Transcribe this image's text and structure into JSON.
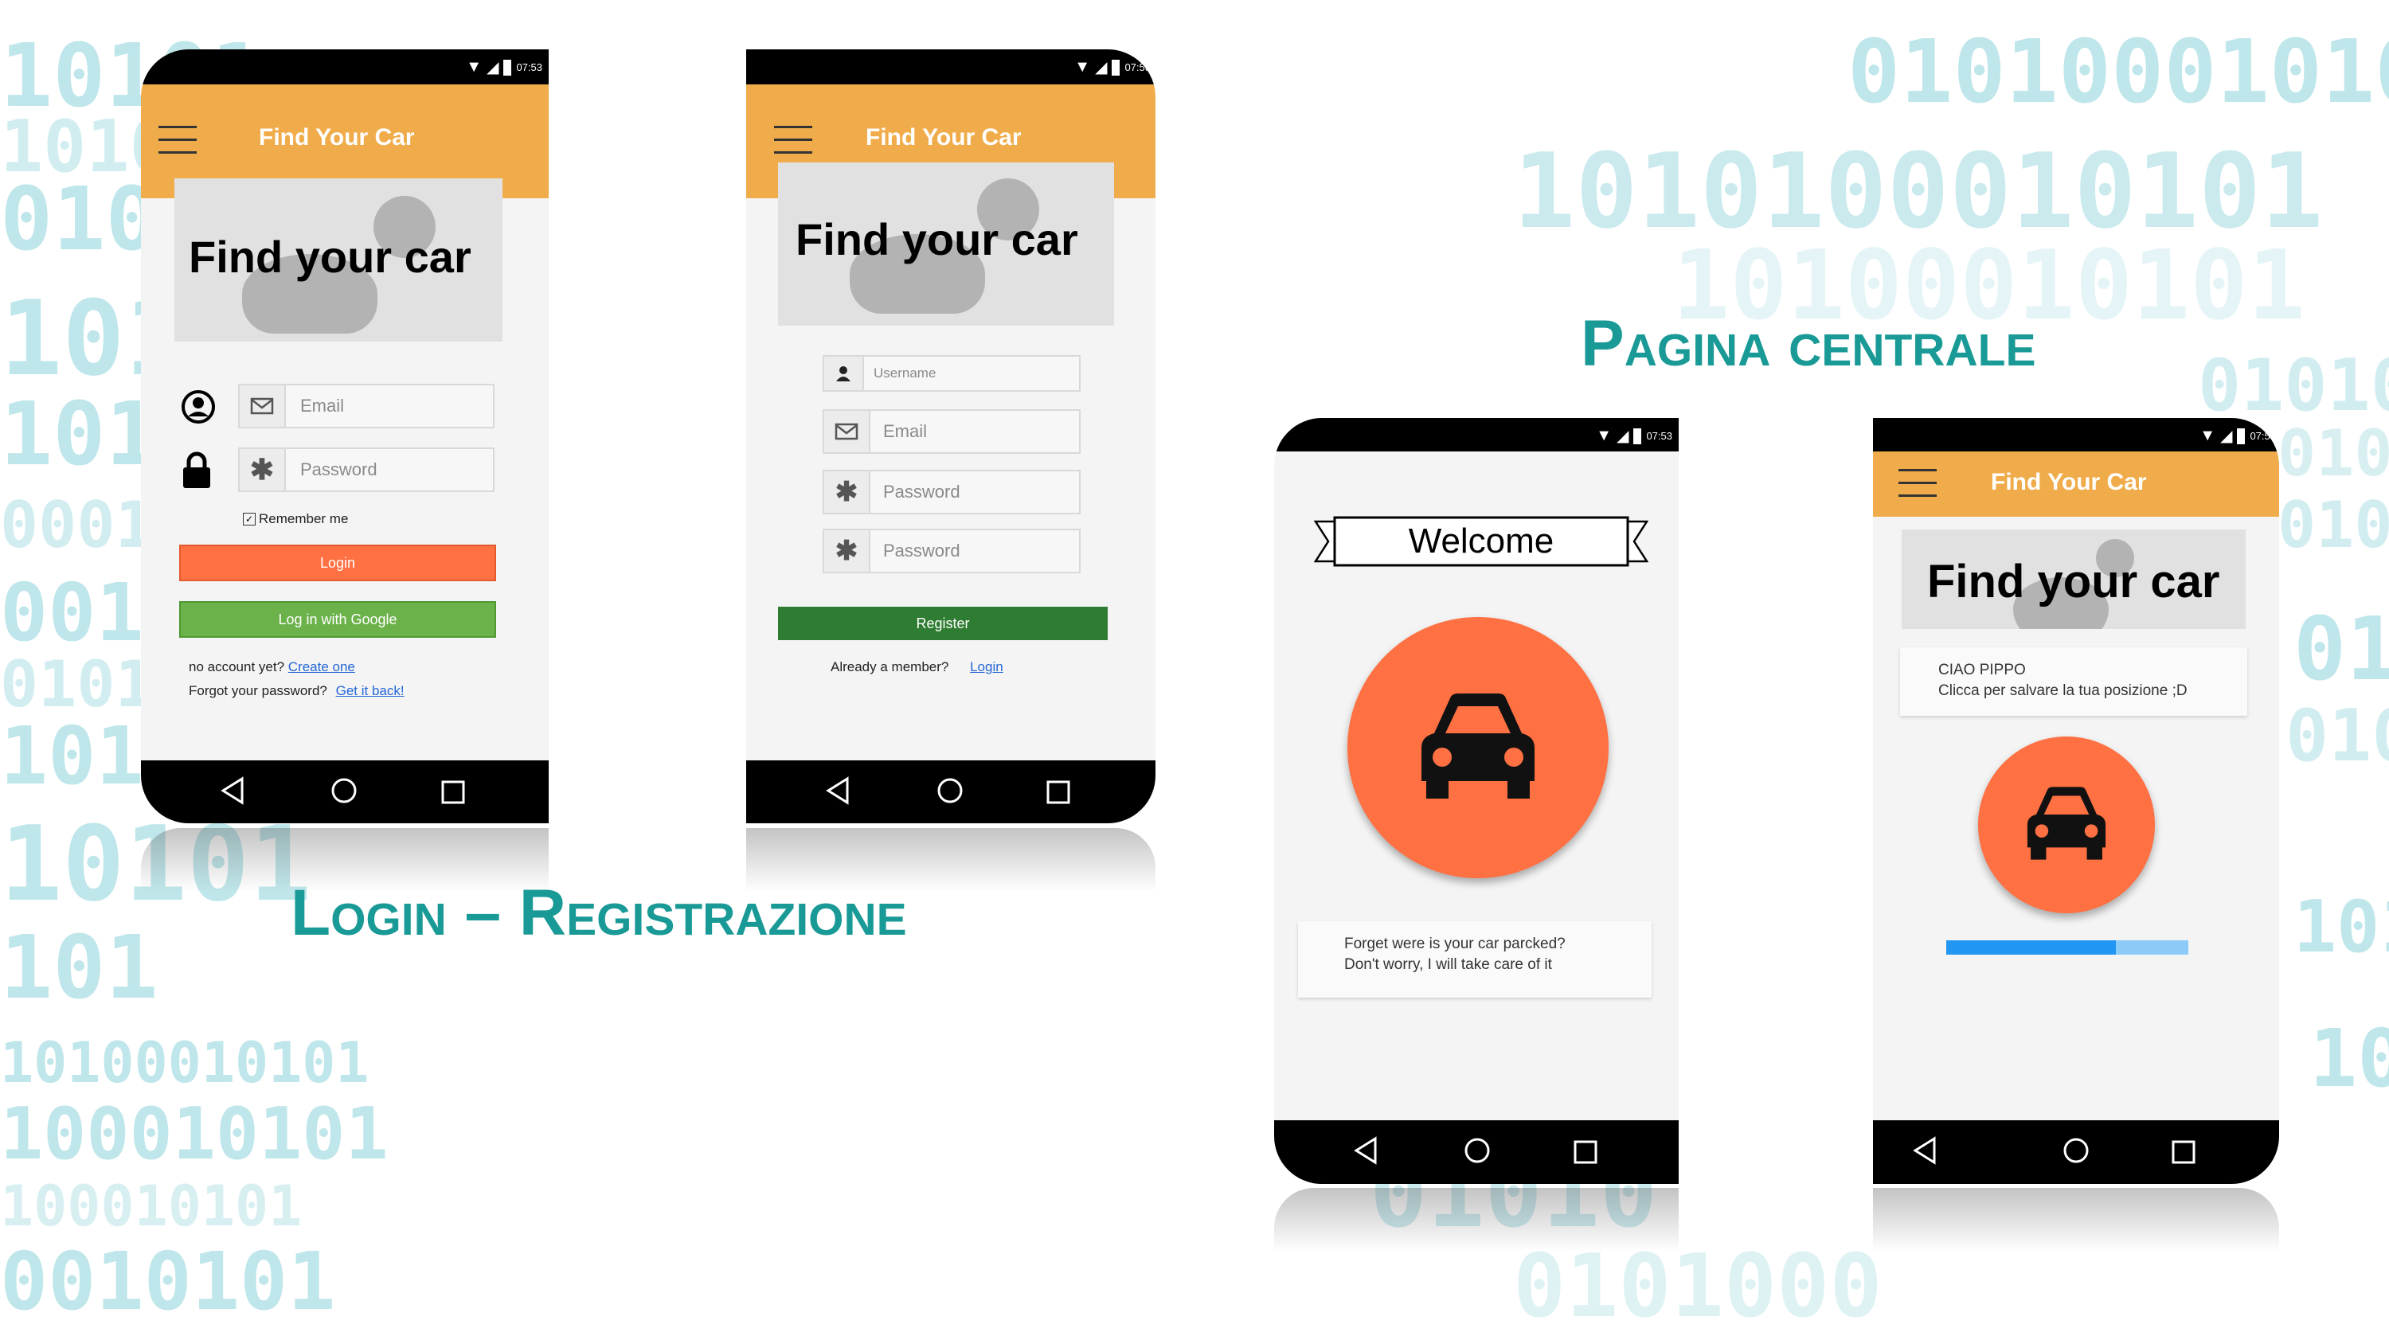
{
  "background": {
    "binary_lines": [
      "10101",
      "1010",
      "0101",
      "101",
      "101",
      "0001",
      "0010",
      "0101",
      "101",
      "10101",
      "101",
      "10100010101",
      "100010101",
      "100010101",
      "0010101",
      "01010001010",
      "1010100010101",
      "10100010101",
      "01010",
      "0101",
      "0101",
      "01",
      "0101",
      "101",
      "10",
      "01010",
      "0101000"
    ]
  },
  "titles": {
    "login_registration": "Login – Registrazione",
    "central_page": "Pagina centrale"
  },
  "app": {
    "name": "Find Your Car",
    "hero_text": "Find your car",
    "status_time": "07:53"
  },
  "login_screen": {
    "email_placeholder": "Email",
    "password_placeholder": "Password",
    "remember_me": "Remember me",
    "login_button": "Login",
    "google_button": "Log in with Google",
    "no_account_text": "no account yet?",
    "create_one_link": "Create one",
    "forgot_text": "Forgot your password?",
    "get_it_back_link": "Get it back!"
  },
  "register_screen": {
    "username_placeholder": "Username",
    "email_placeholder": "Email",
    "password_placeholder": "Password",
    "confirm_password_placeholder": "Password",
    "register_button": "Register",
    "already_member_text": "Already a member?",
    "login_link": "Login"
  },
  "welcome_screen": {
    "banner": "Welcome",
    "card_line1": "Forget were is your car parcked?",
    "card_line2": "Don't worry, I will take care of it"
  },
  "home_screen": {
    "greeting": "CIAO PIPPO",
    "instruction": "Clicca per salvare la tua posizione ;D",
    "progress": 0.7
  },
  "colors": {
    "appbar": "#f0ac4a",
    "accent_orange": "#ff7043",
    "google_green": "#6cb24a",
    "register_green": "#2e7d32",
    "title_teal": "#1a9a96",
    "progress_blue": "#2196f3"
  },
  "icons": [
    "menu-icon",
    "wifi-icon",
    "signal-icon",
    "battery-icon",
    "user-icon",
    "lock-icon",
    "mail-icon",
    "asterisk-icon",
    "car-icon",
    "back-icon",
    "home-icon",
    "recents-icon"
  ]
}
